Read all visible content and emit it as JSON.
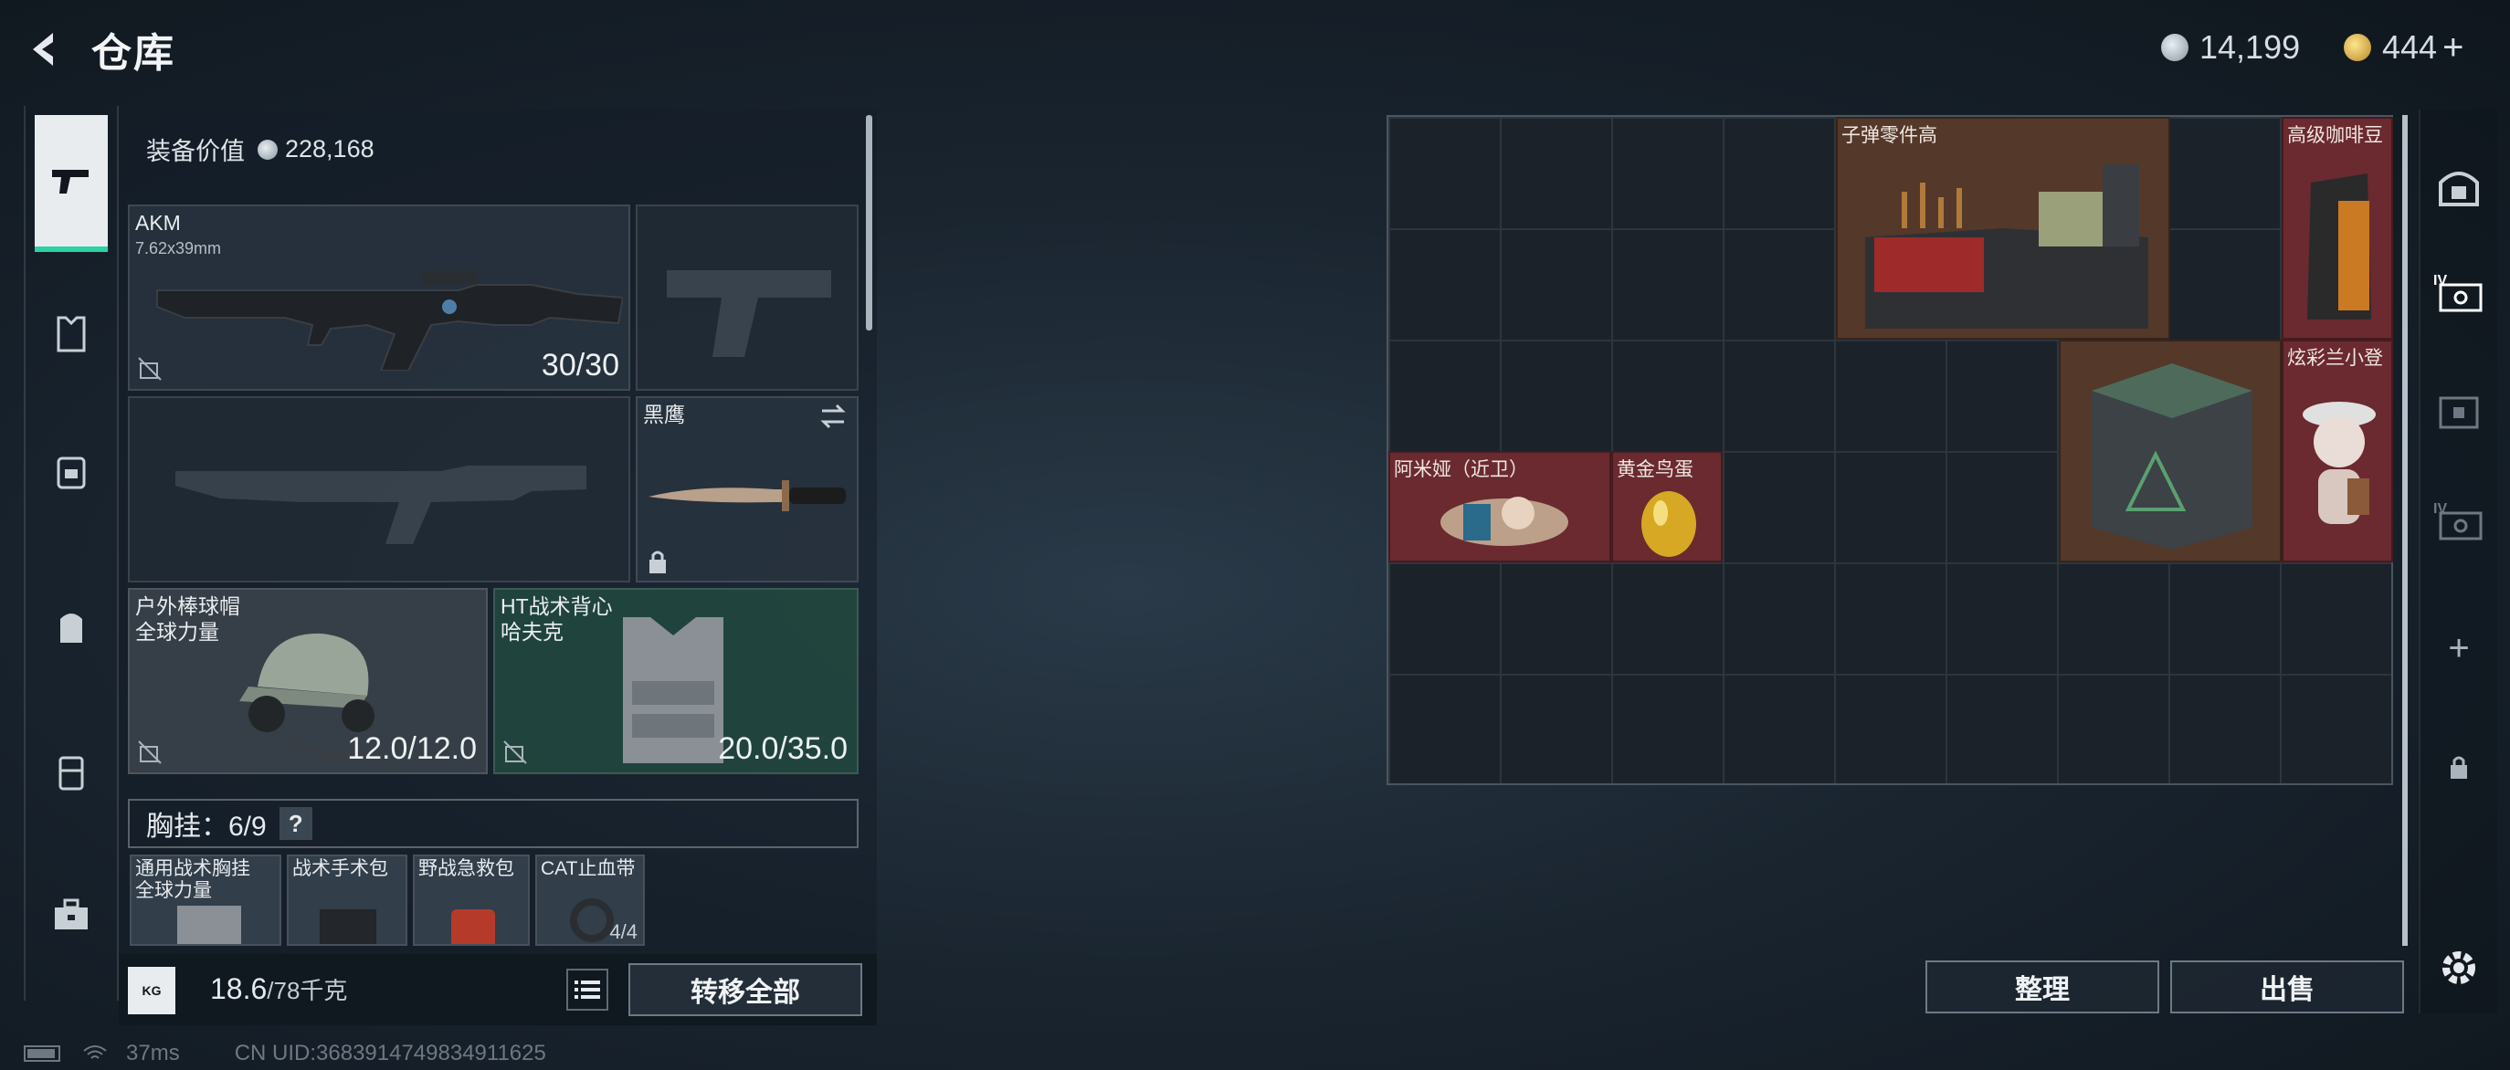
{
  "header": {
    "title": "仓库",
    "currency_silver": "14,199",
    "currency_gold": "444",
    "gold_add": "+"
  },
  "left_nav": {
    "items": [
      "weapon-icon",
      "armor-icon",
      "backpack-icon",
      "bag-icon",
      "case-icon",
      "toolbox-icon"
    ]
  },
  "loadout": {
    "equip_label": "装备价值",
    "equip_value": "228,168",
    "primary": {
      "name": "AKM",
      "ammo_type": "7.62x39mm",
      "count": "30/30"
    },
    "melee": {
      "name": "黑鹰"
    },
    "helmet": {
      "name": "户外棒球帽",
      "sub": "全球力量",
      "count": "12.0/12.0"
    },
    "vest": {
      "name": "HT战术背心",
      "sub": "哈夫克",
      "count": "20.0/35.0"
    },
    "chest_label": "胸挂：6/9",
    "chest_help": "?",
    "chest_items": [
      {
        "name": "通用战术胸挂",
        "sub": "全球力量"
      },
      {
        "name": "战术手术包"
      },
      {
        "name": "野战急救包"
      },
      {
        "name": "CAT止血带",
        "count": "4/4"
      }
    ]
  },
  "bottom_bar": {
    "weight": "18.6",
    "weight_unit": "/78千克",
    "transfer_label": "转移全部",
    "kg_label": "KG"
  },
  "status": {
    "ping": "37ms",
    "uid": "CN UID:3683914749834911625"
  },
  "stash": {
    "items": [
      {
        "name": "子弹零件高",
        "color": "#5a3a2a"
      },
      {
        "name": "高级咖啡豆",
        "color": "#6a2a30"
      },
      {
        "name": "炫彩兰小登",
        "color": "#6a2a30"
      },
      {
        "name": "阿米娅（近卫）",
        "color": "#6a2a30"
      },
      {
        "name": "黄金鸟蛋",
        "color": "#6a2a30"
      },
      {
        "name": "",
        "color": "#5a3a2a"
      }
    ]
  },
  "actions": {
    "sort_label": "整理",
    "sell_label": "出售",
    "add_label": "+"
  },
  "colors": {
    "accent": "#2bd2a4",
    "rare_red": "#6a2a30",
    "rare_brown": "#5a3a2a"
  }
}
